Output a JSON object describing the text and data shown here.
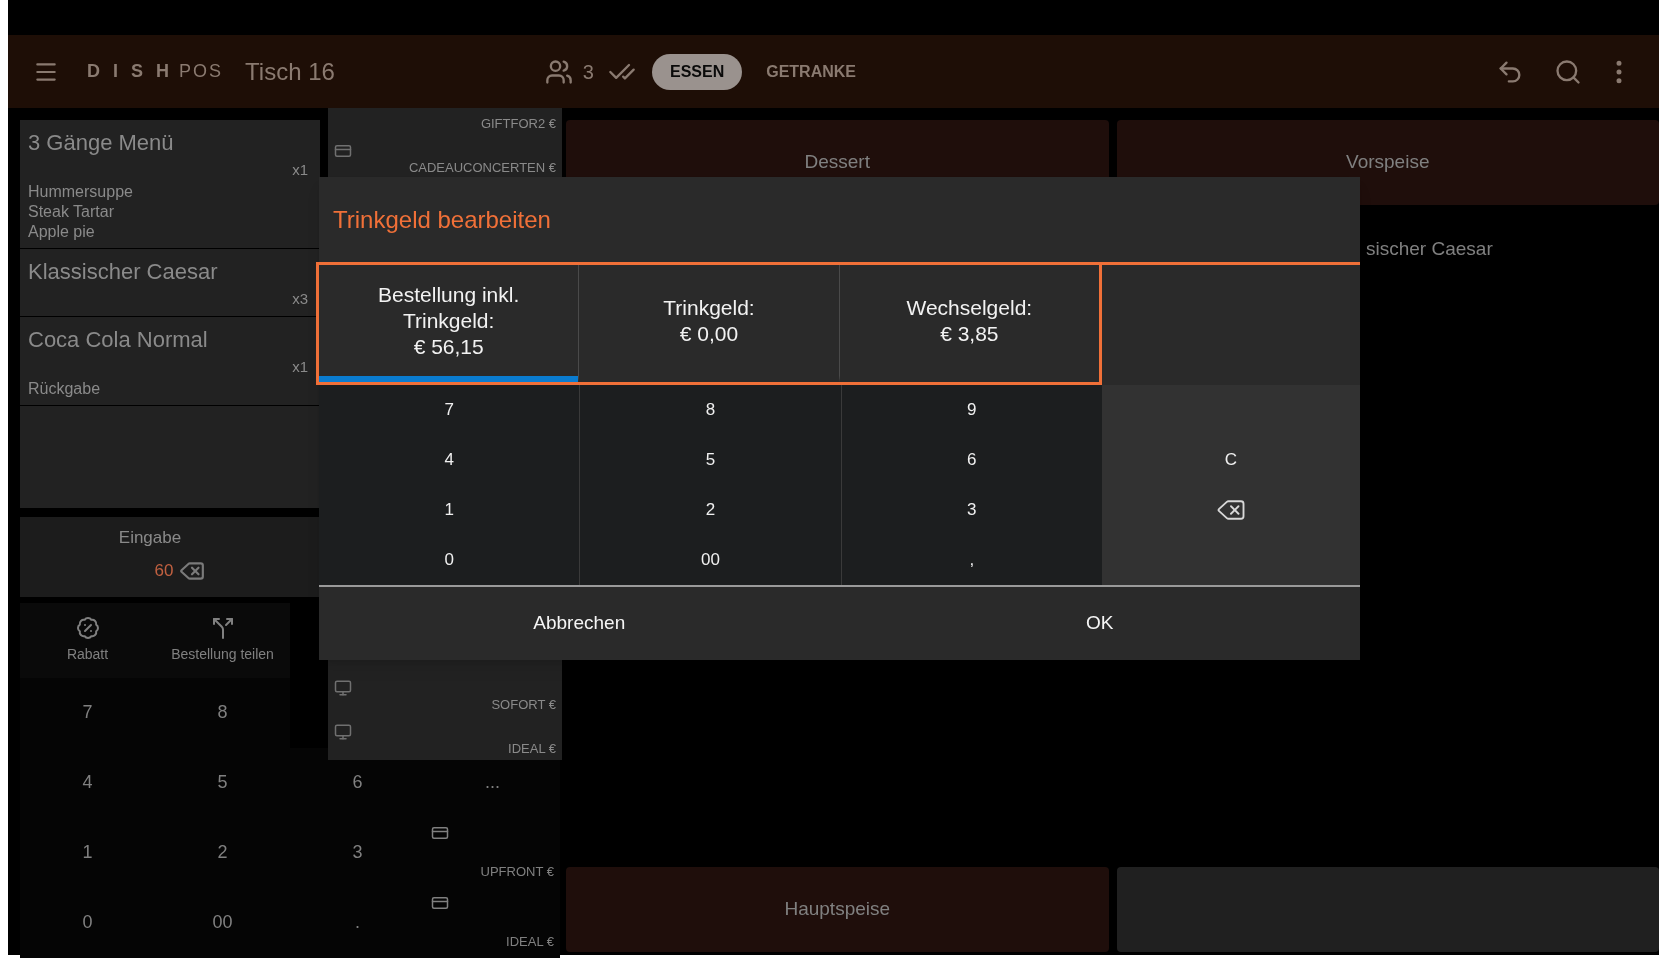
{
  "top_bar": {
    "logo": "D I S H",
    "logo_suffix": "POS",
    "title": "Tisch 16",
    "guests": "3",
    "tabs": [
      {
        "label": "ESSEN",
        "selected": true
      },
      {
        "label": "GETRANKE",
        "selected": false
      }
    ]
  },
  "order_items": [
    {
      "name": "3 Gänge Menü",
      "qty": "x1",
      "details": [
        "Hummersuppe",
        "Steak Tartar",
        "Apple pie"
      ]
    },
    {
      "name": "Klassischer Caesar",
      "qty": "x3"
    },
    {
      "name": "Coca Cola Normal",
      "qty": "x1",
      "details": [
        "Rückgabe"
      ]
    }
  ],
  "input_panel": {
    "label": "Eingabe",
    "value": "60"
  },
  "actions": [
    {
      "label": "Rabatt",
      "kind": "discount"
    },
    {
      "label": "Bestellung teilen",
      "kind": "split"
    }
  ],
  "background_keypad": [
    [
      {
        "label": "7",
        "kind": "key"
      },
      {
        "label": "8",
        "kind": "key"
      }
    ],
    [
      {
        "label": "4",
        "kind": "key"
      },
      {
        "label": "5",
        "kind": "key"
      },
      {
        "label": "6",
        "kind": "key"
      },
      {
        "label": "...",
        "kind": "key"
      }
    ],
    [
      {
        "label": "1",
        "kind": "key"
      },
      {
        "label": "2",
        "kind": "key"
      },
      {
        "label": "3",
        "kind": "key"
      },
      {
        "label": "UPFRONT €",
        "kind": "payment"
      }
    ],
    [
      {
        "label": "0",
        "kind": "key"
      },
      {
        "label": "00",
        "kind": "key"
      },
      {
        "label": ".",
        "kind": "key"
      },
      {
        "label": "IDEAL €",
        "kind": "payment"
      }
    ]
  ],
  "payment_menu": {
    "top_items": [
      {
        "label": "GIFTFOR2 €",
        "kind": "clipped"
      },
      {
        "label": "CADEAUCONCERTEN €",
        "kind": "card"
      }
    ],
    "bottom_items": [
      {
        "label": "SOFORT €",
        "kind": "monitor"
      },
      {
        "label": "IDEAL €",
        "kind": "monitor"
      }
    ]
  },
  "top_tiles": [
    {
      "label": "Dessert",
      "color": "#1f0e0b"
    },
    {
      "label": "Vorspeise",
      "color": "#1f0e0b"
    }
  ],
  "right_list_item": "sischer Caesar",
  "bottom_tiles": [
    {
      "label": "Hauptspeise",
      "color": "#1f0e0b"
    },
    {
      "color": "#202020"
    }
  ],
  "dialog": {
    "title": "Trinkgeld bearbeiten",
    "tabs_highlighted": true,
    "tabs": [
      {
        "label": "Bestellung inkl. Trinkgeld:",
        "amount": "€ 56,15",
        "selected": true
      },
      {
        "label": "Trinkgeld:",
        "amount": "€ 0,00",
        "selected": false
      },
      {
        "label": "Wechselgeld:",
        "amount": "€ 3,85",
        "selected": false
      }
    ],
    "keys": [
      [
        "7",
        "8",
        "9"
      ],
      [
        "4",
        "5",
        "6"
      ],
      [
        "1",
        "2",
        "3"
      ],
      [
        "0",
        "00",
        ","
      ]
    ],
    "side_keys": [
      {
        "kind": "clear",
        "label": "C"
      },
      {
        "kind": "backspace"
      }
    ],
    "buttons": [
      "Abbrechen",
      "OK"
    ]
  }
}
